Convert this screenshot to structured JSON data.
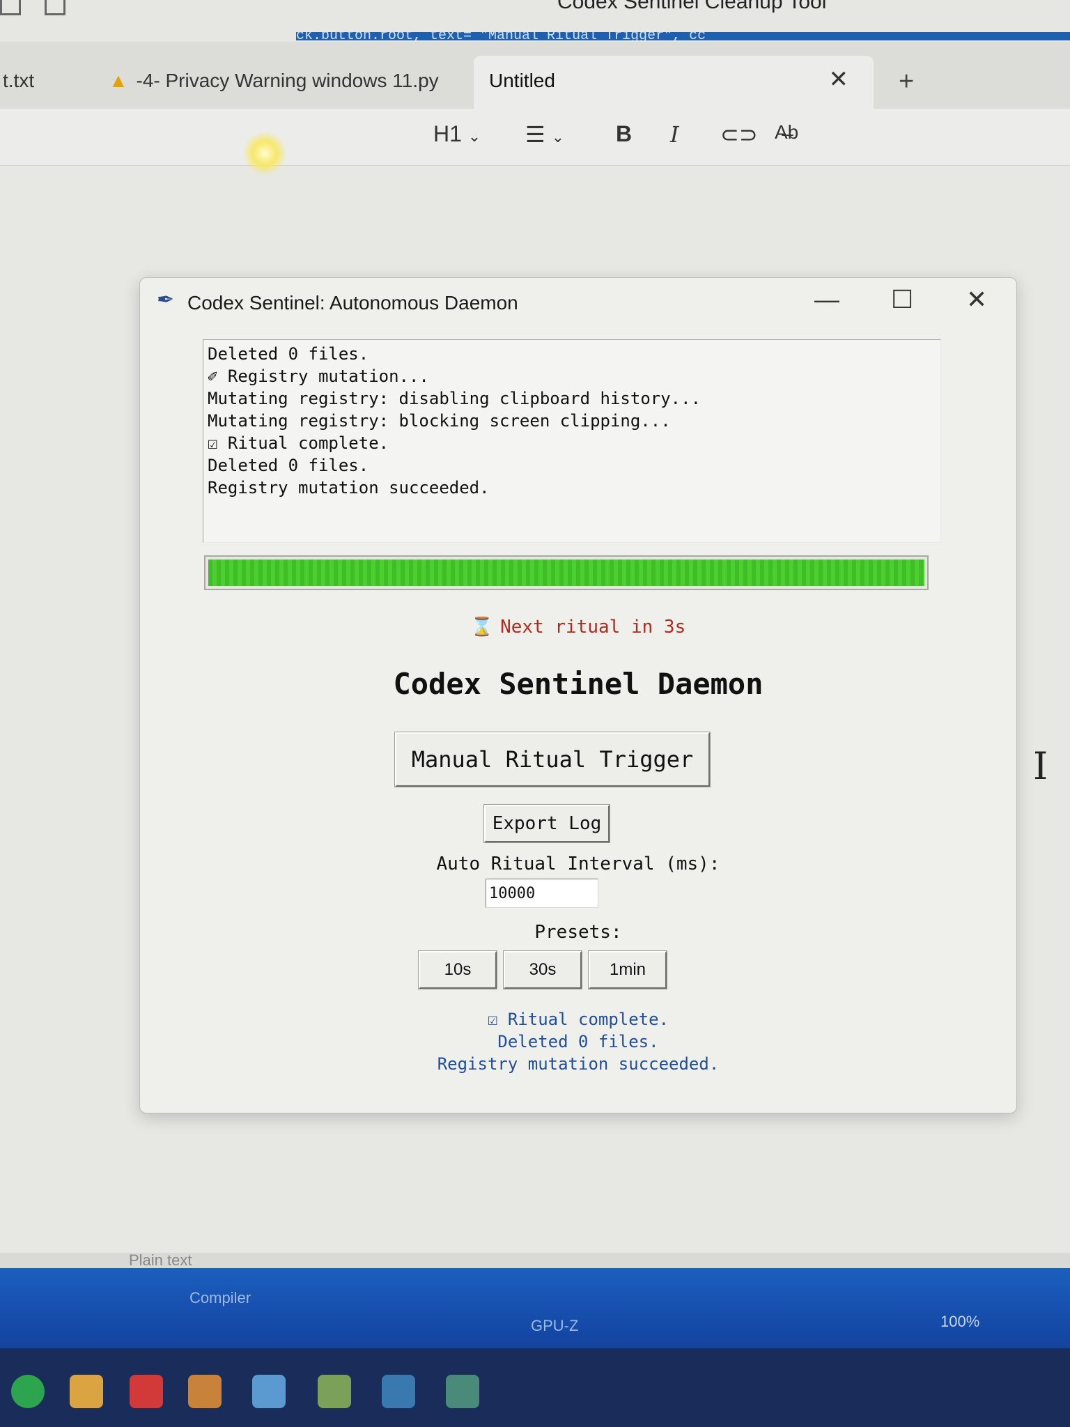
{
  "top": {
    "window_title": "Codex Sentinel Cleanup Tool",
    "stripe_text": "ck.button.root, text= \"Manual Ritual Trigger\",  cc"
  },
  "tabs": [
    {
      "label": "t.txt"
    },
    {
      "label": "-4- Privacy Warning windows 11.py",
      "icon": "warning-icon"
    },
    {
      "label": "Untitled",
      "active": true
    }
  ],
  "toolbar": {
    "heading": "H1",
    "bold": "B",
    "italic": "I",
    "icons": [
      "heading-dropdown",
      "list-icon",
      "bold-icon",
      "italic-icon",
      "link-icon",
      "spellcheck-icon"
    ]
  },
  "daemon": {
    "title": "Codex Sentinel: Autonomous Daemon",
    "log_lines": [
      "Deleted 0 files.",
      "✐ Registry mutation...",
      "Mutating registry: disabling clipboard history...",
      "Mutating registry: blocking screen clipping...",
      "☑ Ritual complete.",
      "Deleted 0 files.",
      "Registry mutation succeeded."
    ],
    "progress": 1.0,
    "progress_color": "#3fbf25",
    "next_ritual": "Next ritual in 3s",
    "heading": "Codex Sentinel Daemon",
    "manual_button": "Manual Ritual Trigger",
    "export_button": "Export Log",
    "interval_label": "Auto Ritual Interval (ms):",
    "interval_value": "10000",
    "presets_label": "Presets:",
    "presets": [
      "10s",
      "30s",
      "1min"
    ],
    "status_lines": [
      "☑ Ritual complete.",
      "Deleted 0 files.",
      "Registry mutation succeeded."
    ]
  },
  "statusbar": {
    "left": "Plain text",
    "zoom": "100%"
  },
  "desktop": {
    "labels": [
      "Compiler",
      "GPU-Z"
    ]
  },
  "colors": {
    "accent_red": "#b02a20",
    "status_blue": "#1f4f9c",
    "taskbar": "#1a2c5a"
  }
}
